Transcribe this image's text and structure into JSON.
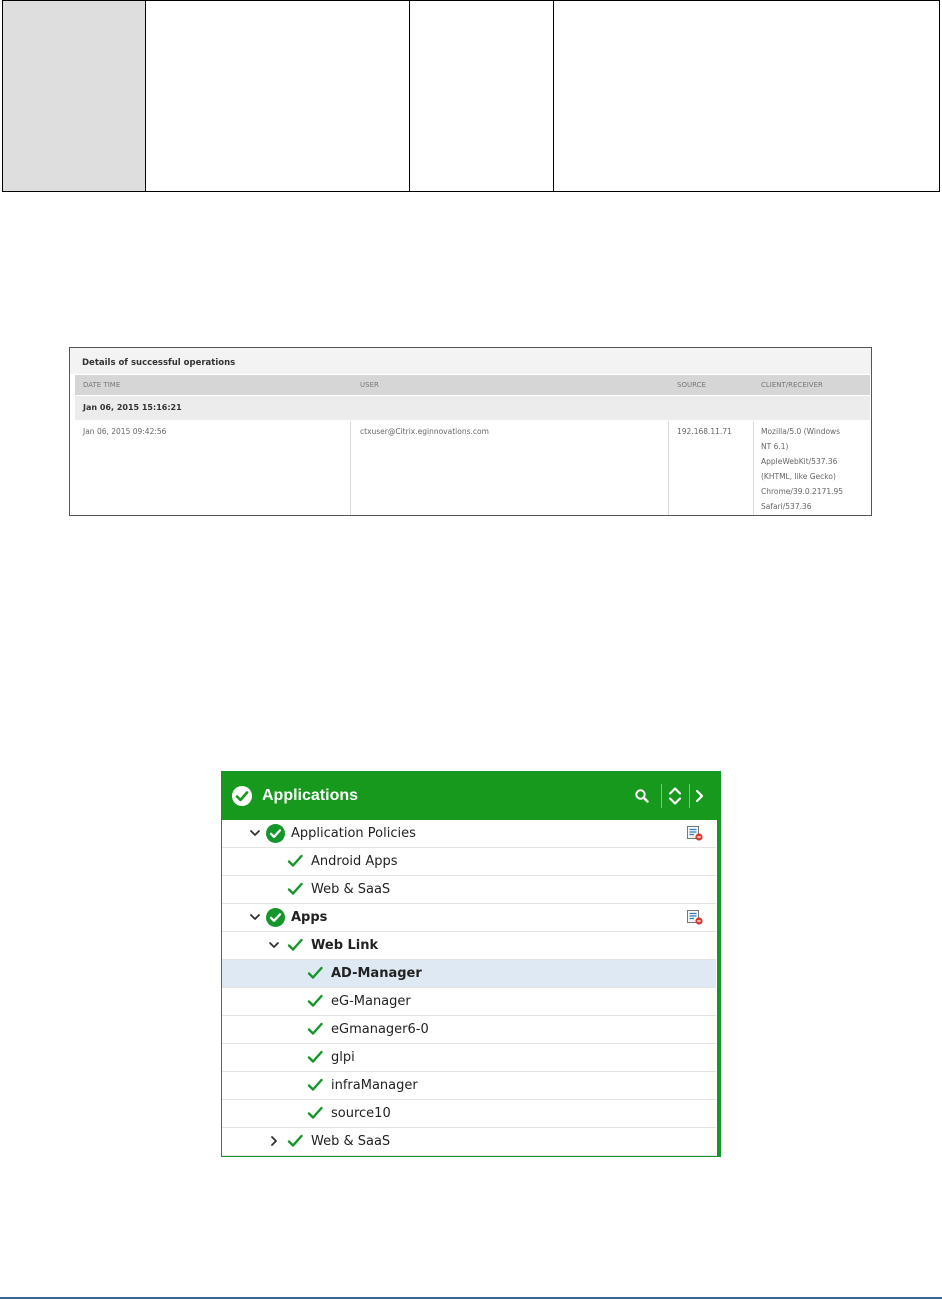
{
  "details_panel": {
    "title": "Details of successful operations",
    "columns": [
      "DATE TIME",
      "USER",
      "SOURCE",
      "CLIENT/RECEIVER"
    ],
    "group_label": "Jan 06, 2015 15:16:21",
    "row": {
      "date_time": "Jan 06, 2015 09:42:56",
      "user": "ctxuser@Citrix.eginnovations.com",
      "source": "192.168.11.71",
      "client_receiver_lines": [
        "Mozilla/5.0 (Windows",
        "NT 6.1)",
        "AppleWebKit/537.36",
        "(KHTML, like Gecko)",
        "Chrome/39.0.2171.95",
        "Safari/537.36"
      ]
    }
  },
  "applications_panel": {
    "title": "Applications",
    "status_color": "#16991d",
    "tools": [
      "search-icon",
      "sort-icon",
      "chevron-right-icon"
    ],
    "tree": [
      {
        "label": "Application Policies",
        "level": 0,
        "bold": false,
        "expand": "expanded",
        "status": "ok-circle",
        "policy_icon": true,
        "selected": false
      },
      {
        "label": "Android Apps",
        "level": 1,
        "bold": false,
        "expand": "none",
        "status": "tick",
        "policy_icon": false,
        "selected": false
      },
      {
        "label": "Web & SaaS",
        "level": 1,
        "bold": false,
        "expand": "none",
        "status": "tick",
        "policy_icon": false,
        "selected": false
      },
      {
        "label": "Apps",
        "level": 0,
        "bold": true,
        "expand": "expanded",
        "status": "ok-circle",
        "policy_icon": true,
        "selected": false
      },
      {
        "label": "Web Link",
        "level": 1,
        "bold": true,
        "expand": "expanded",
        "status": "tick",
        "policy_icon": false,
        "selected": false
      },
      {
        "label": "AD-Manager",
        "level": 2,
        "bold": true,
        "expand": "none",
        "status": "tick",
        "policy_icon": false,
        "selected": true
      },
      {
        "label": "eG-Manager",
        "level": 2,
        "bold": false,
        "expand": "none",
        "status": "tick",
        "policy_icon": false,
        "selected": false
      },
      {
        "label": "eGmanager6-0",
        "level": 2,
        "bold": false,
        "expand": "none",
        "status": "tick",
        "policy_icon": false,
        "selected": false
      },
      {
        "label": "glpi",
        "level": 2,
        "bold": false,
        "expand": "none",
        "status": "tick",
        "policy_icon": false,
        "selected": false
      },
      {
        "label": "infraManager",
        "level": 2,
        "bold": false,
        "expand": "none",
        "status": "tick",
        "policy_icon": false,
        "selected": false
      },
      {
        "label": "source10",
        "level": 2,
        "bold": false,
        "expand": "none",
        "status": "tick",
        "policy_icon": false,
        "selected": false
      },
      {
        "label": "Web & SaaS",
        "level": 1,
        "bold": false,
        "expand": "collapsed",
        "status": "tick",
        "policy_icon": false,
        "selected": false
      }
    ]
  }
}
